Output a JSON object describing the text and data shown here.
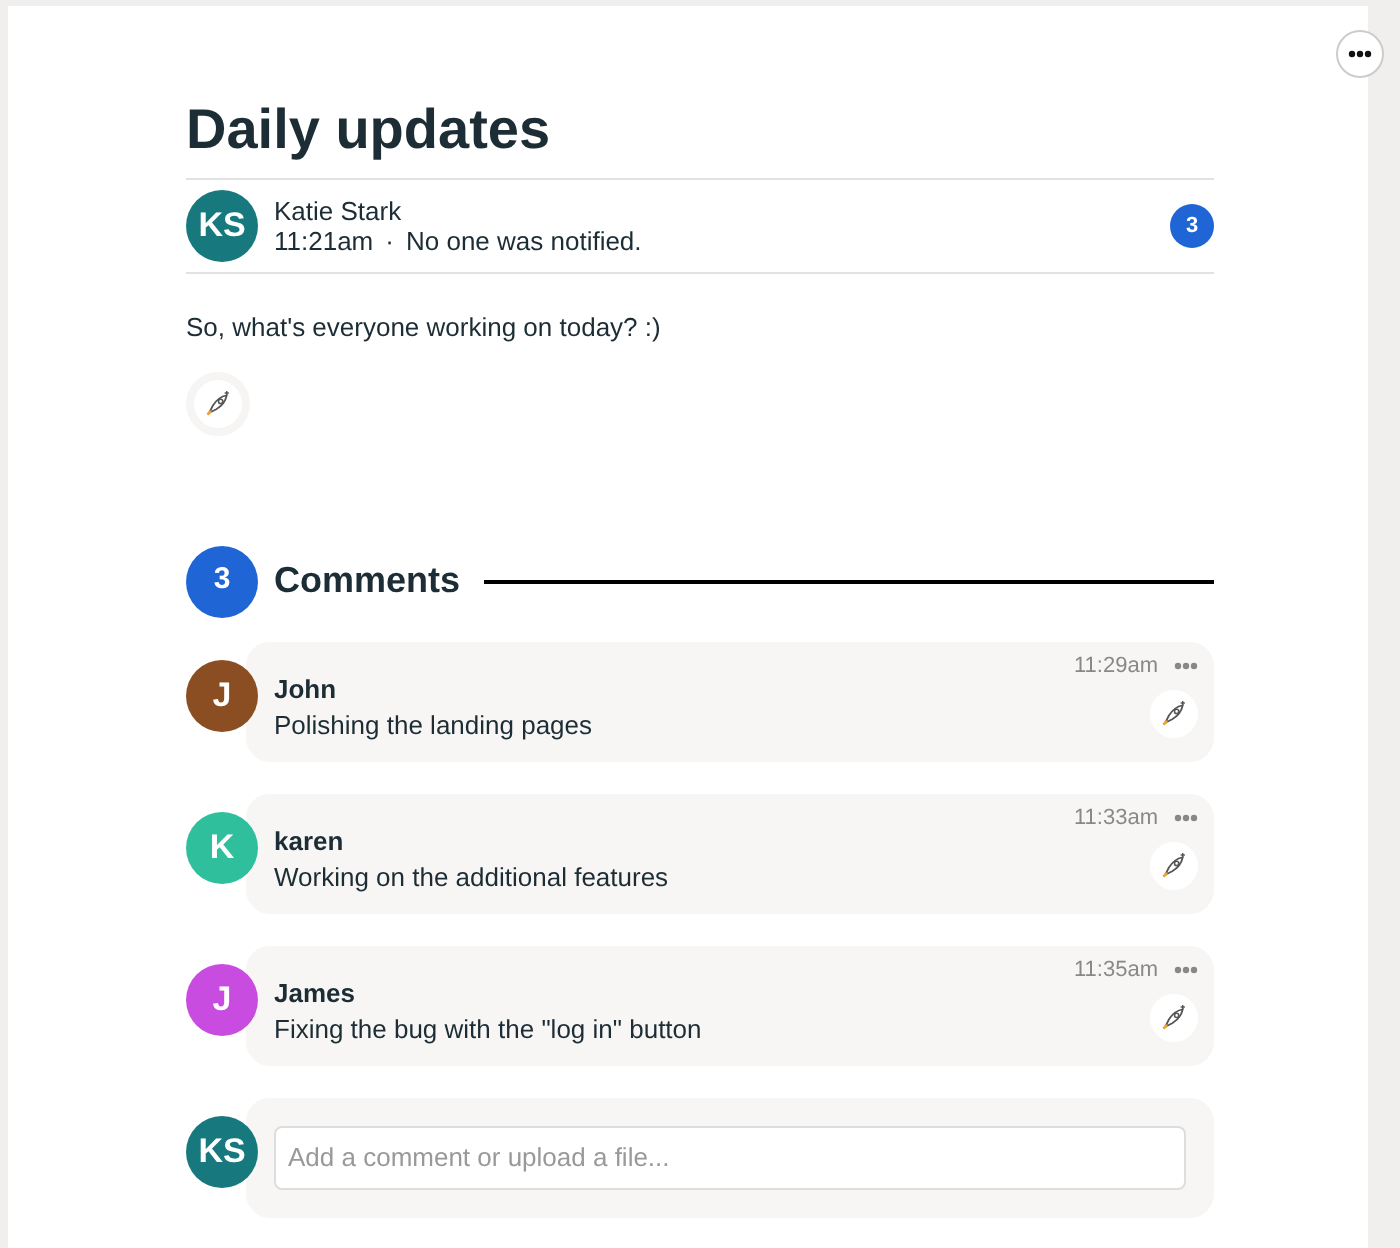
{
  "title": "Daily updates",
  "author": {
    "initials": "KS",
    "name": "Katie Stark",
    "color": "#17797e",
    "time": "11:21am",
    "separator": "·",
    "notice": "No one was notified.",
    "count": "3"
  },
  "body": "So, what's everyone working on today? :)",
  "comments_header": {
    "count": "3",
    "label": "Comments"
  },
  "comments": [
    {
      "initials": "J",
      "name": "John",
      "color": "#8a4e22",
      "time": "11:29am",
      "text": "Polishing the landing pages"
    },
    {
      "initials": "K",
      "name": "karen",
      "color": "#2fbf9c",
      "time": "11:33am",
      "text": "Working on the additional features"
    },
    {
      "initials": "J",
      "name": "James",
      "color": "#c94ce0",
      "time": "11:35am",
      "text": "Fixing the bug with the \"log in\" button"
    }
  ],
  "composer": {
    "initials": "KS",
    "color": "#17797e",
    "placeholder": "Add a comment or upload a file..."
  }
}
